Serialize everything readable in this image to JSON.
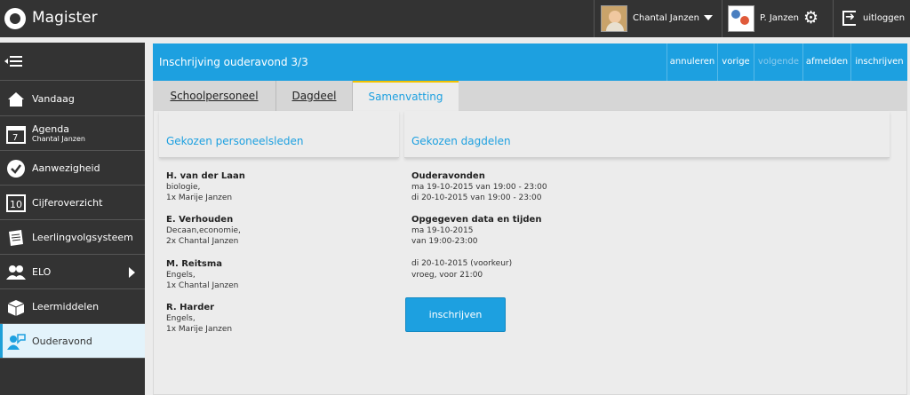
{
  "app": {
    "title": "Magister"
  },
  "topbar": {
    "user_name": "Chantal Janzen",
    "parent_name": "P. Janzen",
    "logout_label": "uitloggen"
  },
  "sidebar": {
    "items": [
      {
        "label": "Vandaag",
        "icon": "sun-icon"
      },
      {
        "label": "Agenda",
        "sub": "Chantal Janzen",
        "icon": "calendar-icon",
        "day": "7"
      },
      {
        "label": "Aanwezigheid",
        "icon": "check-icon"
      },
      {
        "label": "Cijferoverzicht",
        "icon": "grade-icon",
        "grade": "10"
      },
      {
        "label": "Leerlingvolgsysteem",
        "icon": "notebook-icon"
      },
      {
        "label": "ELO",
        "icon": "users-icon"
      },
      {
        "label": "Leermiddelen",
        "icon": "box-icon"
      },
      {
        "label": "Ouderavond",
        "icon": "parents-evening-icon",
        "active": true
      }
    ]
  },
  "header": {
    "title": "Inschrijving ouderavond 3/3",
    "buttons": {
      "cancel": "annuleren",
      "previous": "vorige",
      "next": "volgende",
      "signout": "afmelden",
      "enroll": "inschrijven"
    }
  },
  "tabs": {
    "staff": "Schoolpersoneel",
    "daypart": "Dagdeel",
    "summary": "Samenvatting"
  },
  "staff_section": {
    "title": "Gekozen personeelsleden",
    "members": [
      {
        "name": "H. van der Laan",
        "subject": "biologie,",
        "count": "1x Marije Janzen"
      },
      {
        "name": "E. Verhouden",
        "subject": "Decaan,economie,",
        "count": "2x Chantal Janzen"
      },
      {
        "name": "M. Reitsma",
        "subject": "Engels,",
        "count": "1x Chantal Janzen"
      },
      {
        "name": "R. Harder",
        "subject": "Engels,",
        "count": "1x Marije Janzen"
      }
    ]
  },
  "daypart_section": {
    "title": "Gekozen dagdelen",
    "evenings_title": "Ouderavonden",
    "evenings": [
      "ma 19-10-2015 van 19:00 - 23:00",
      "di 20-10-2015 van 19:00 - 23:00"
    ],
    "given_title": "Opgegeven data en tijden",
    "given_a": [
      "ma 19-10-2015",
      "van 19:00-23:00"
    ],
    "given_b": [
      "di 20-10-2015 (voorkeur)",
      "vroeg, voor 21:00"
    ],
    "enroll_button": "inschrijven"
  },
  "colors": {
    "accent": "#1da0e0",
    "topbar": "#333333",
    "active_tab_border": "#f2c200"
  }
}
